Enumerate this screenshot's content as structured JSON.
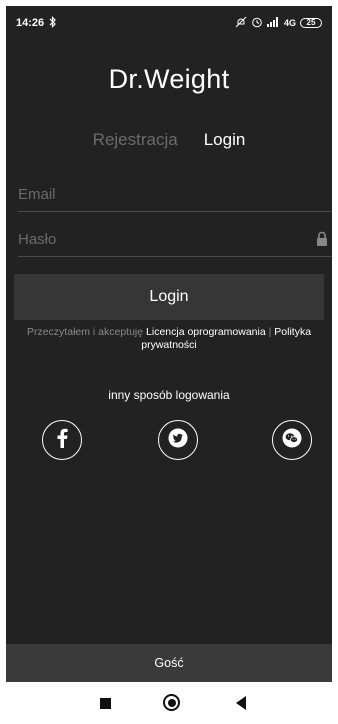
{
  "status_bar": {
    "time": "14:26",
    "network": "4G",
    "battery": "25"
  },
  "app": {
    "title": "Dr.Weight"
  },
  "tabs": {
    "register": "Rejestracja",
    "login": "Login"
  },
  "form": {
    "email_placeholder": "Email",
    "password_placeholder": "Hasło",
    "submit_label": "Login"
  },
  "terms": {
    "prefix": "Przeczytałem i akceptuję",
    "license_link": "Licencja oprogramowania",
    "separator": "|",
    "privacy_link": "Polityka prywatności"
  },
  "alt_login": {
    "label": "inny sposób logowania",
    "providers": [
      "facebook",
      "twitter",
      "wechat"
    ]
  },
  "guest": {
    "label": "Gość"
  },
  "colors": {
    "background": "#222222",
    "button": "#363636",
    "guest_bar": "#3a3a3a",
    "inactive_tab": "#6b6b6b"
  }
}
